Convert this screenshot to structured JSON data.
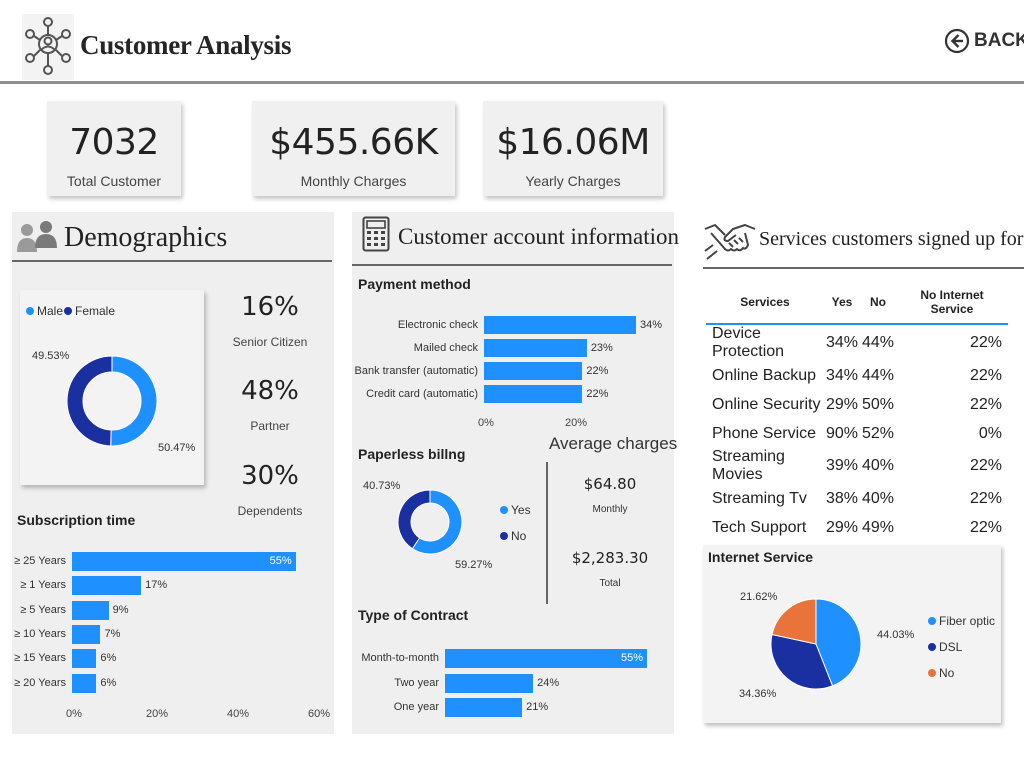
{
  "header": {
    "title": "Customer Analysis",
    "back_label": "BACK",
    "logo_icon": "customer-network-icon",
    "back_icon": "arrow-left-circle-icon"
  },
  "kpis": [
    {
      "value": "7032",
      "label": "Total Customer"
    },
    {
      "value": "$455.66K",
      "label": "Monthly Charges"
    },
    {
      "value": "$16.06M",
      "label": "Yearly Charges"
    }
  ],
  "demographics": {
    "title": "Demographics",
    "icon": "users-icon",
    "gender_legend": [
      {
        "name": "Male",
        "color": "#1e90ff"
      },
      {
        "name": "Female",
        "color": "#1a2fa0"
      }
    ],
    "gender_labels": {
      "female_pct": "49.53%",
      "male_pct": "50.47%"
    },
    "stats": [
      {
        "value": "16%",
        "label": "Senior Citizen"
      },
      {
        "value": "48%",
        "label": "Partner"
      },
      {
        "value": "30%",
        "label": "Dependents"
      }
    ]
  },
  "subscription": {
    "title": "Subscription time",
    "ticks": [
      "0%",
      "20%",
      "40%",
      "60%"
    ]
  },
  "account": {
    "title": "Customer account information",
    "icon": "calculator-icon",
    "payment_title": "Payment method",
    "payment_ticks": [
      "0%",
      "20%"
    ],
    "paperless_title": "Paperless billng",
    "paperless_legend": [
      {
        "name": "Yes",
        "color": "#1e90ff"
      },
      {
        "name": "No",
        "color": "#1a2fa0"
      }
    ],
    "paperless_labels": {
      "no_pct": "40.73%",
      "yes_pct": "59.27%"
    },
    "avg_title": "Average charges",
    "avg_monthly_value": "$64.80",
    "avg_monthly_label": "Monthly",
    "avg_total_value": "$2,283.30",
    "avg_total_label": "Total",
    "contract_title": "Type of Contract"
  },
  "services": {
    "title": "Services customers signed up for",
    "icon": "handshake-icon",
    "headers": [
      "Services",
      "Yes",
      "No",
      "No Internet Service"
    ],
    "rows": [
      [
        "Device Protection",
        "34%",
        "44%",
        "22%"
      ],
      [
        "Online Backup",
        "34%",
        "44%",
        "22%"
      ],
      [
        "Online Security",
        "29%",
        "50%",
        "22%"
      ],
      [
        "Phone Service",
        "90%",
        "52%",
        "0%"
      ],
      [
        "Streaming Movies",
        "39%",
        "40%",
        "22%"
      ],
      [
        "Streaming Tv",
        "38%",
        "40%",
        "22%"
      ],
      [
        "Tech Support",
        "29%",
        "49%",
        "22%"
      ]
    ]
  },
  "internet": {
    "title": "Internet Service",
    "legend": [
      {
        "name": "Fiber optic",
        "color": "#1e90ff"
      },
      {
        "name": "DSL",
        "color": "#1a2fa0"
      },
      {
        "name": "No",
        "color": "#e8743b"
      }
    ],
    "labels": {
      "no_pct": "21.62%",
      "fiber_pct": "44.03%",
      "dsl_pct": "34.36%"
    }
  },
  "chart_data": [
    {
      "type": "pie",
      "variant": "donut",
      "categories": [
        "Male",
        "Female"
      ],
      "values": [
        50.47,
        49.53
      ],
      "colors": [
        "#1e90ff",
        "#1a2fa0"
      ]
    },
    {
      "type": "bar",
      "orientation": "horizontal",
      "title": "Subscription time",
      "categories": [
        "≥ 25 Years",
        "≥ 1 Years",
        "≥ 5 Years",
        "≥ 10 Years",
        "≥ 15 Years",
        "≥ 20 Years"
      ],
      "values": [
        55,
        17,
        9,
        7,
        6,
        6
      ],
      "value_labels": [
        "55%",
        "17%",
        "9%",
        "7%",
        "6%",
        "6%"
      ],
      "xlim": [
        0,
        60
      ],
      "color": "#1e90ff"
    },
    {
      "type": "bar",
      "orientation": "horizontal",
      "title": "Payment method",
      "categories": [
        "Electronic check",
        "Mailed check",
        "Bank transfer (automatic)",
        "Credit card (automatic)"
      ],
      "values": [
        34,
        23,
        22,
        22
      ],
      "value_labels": [
        "34%",
        "23%",
        "22%",
        "22%"
      ],
      "xlim": [
        0,
        34
      ],
      "color": "#1e90ff"
    },
    {
      "type": "pie",
      "variant": "donut",
      "title": "Paperless billng",
      "categories": [
        "Yes",
        "No"
      ],
      "values": [
        59.27,
        40.73
      ],
      "colors": [
        "#1e90ff",
        "#1a2fa0"
      ]
    },
    {
      "type": "bar",
      "orientation": "horizontal",
      "title": "Type of Contract",
      "categories": [
        "Month-to-month",
        "Two year",
        "One year"
      ],
      "values": [
        55,
        24,
        21
      ],
      "value_labels": [
        "55%",
        "24%",
        "21%"
      ],
      "xlim": [
        0,
        55
      ],
      "color": "#1e90ff"
    },
    {
      "type": "pie",
      "title": "Internet Service",
      "categories": [
        "Fiber optic",
        "DSL",
        "No"
      ],
      "values": [
        44.03,
        34.36,
        21.62
      ],
      "colors": [
        "#1e90ff",
        "#1a2fa0",
        "#e8743b"
      ]
    }
  ]
}
